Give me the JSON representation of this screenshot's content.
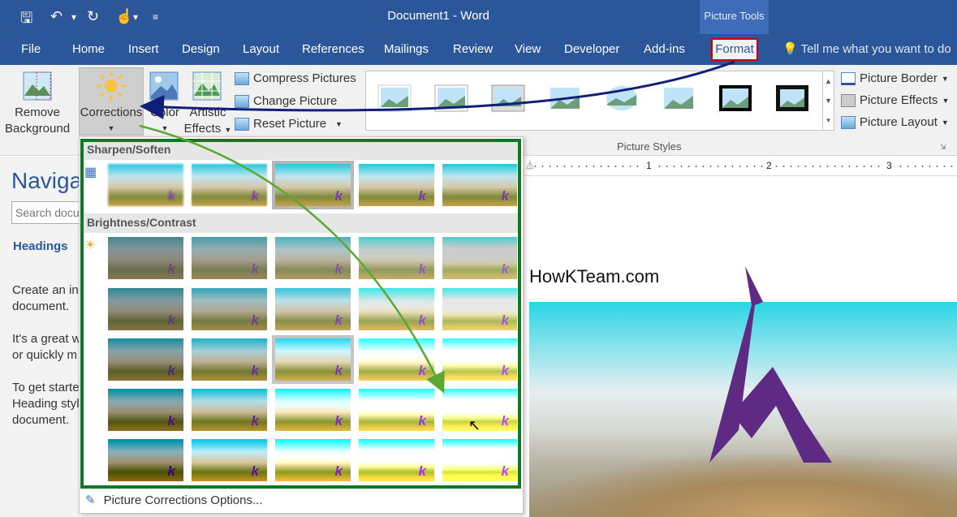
{
  "window": {
    "title": "Document1 - Word",
    "context_tab_group": "Picture Tools",
    "quick_access": [
      {
        "name": "save-icon",
        "glyph": "🖫"
      },
      {
        "name": "undo-icon",
        "glyph": "↶"
      },
      {
        "name": "undo-dropdown-icon",
        "glyph": "▾"
      },
      {
        "name": "redo-icon",
        "glyph": "↻"
      },
      {
        "name": "touch-mode-icon",
        "glyph": "☝"
      },
      {
        "name": "touch-dropdown-icon",
        "glyph": "▾"
      },
      {
        "name": "customize-qat-icon",
        "glyph": "≡"
      }
    ]
  },
  "tabs": [
    "File",
    "Home",
    "Insert",
    "Design",
    "Layout",
    "References",
    "Mailings",
    "Review",
    "View",
    "Developer",
    "Add-ins"
  ],
  "active_tab": "Format",
  "tell_me": "Tell me what you want to do",
  "ribbon": {
    "remove_background": [
      "Remove",
      "Background"
    ],
    "corrections": "Corrections",
    "color": "Color",
    "artistic_effects": [
      "Artistic",
      "Effects"
    ],
    "compress_pictures": "Compress Pictures",
    "change_picture": "Change Picture",
    "reset_picture": "Reset Picture",
    "picture_border": "Picture Border",
    "picture_effects": "Picture Effects",
    "picture_layout": "Picture Layout",
    "styles_group_label": "Picture Styles"
  },
  "nav_pane": {
    "title": "Naviga",
    "search_placeholder": "Search docu",
    "headings_tab": "Headings",
    "text_lines": [
      "Create an int",
      "document.",
      "It's a great w",
      "or quickly m",
      "To get starte",
      "Heading styl",
      "document."
    ]
  },
  "ruler": {
    "numbers": [
      "1",
      "2",
      "3"
    ]
  },
  "document": {
    "text": "HowKTeam.com"
  },
  "dropdown": {
    "sharpen_soften_label": "Sharpen/Soften",
    "brightness_contrast_label": "Brightness/Contrast",
    "thumb_mark": "k",
    "options_link": "Picture Corrections Options..."
  },
  "colors": {
    "title_bar": "#2b579a",
    "format_highlight": "#cc0000",
    "green_frame": "#0b7a22",
    "arrow_navy": "#0f1f7a",
    "arrow_green": "#5aa832"
  }
}
